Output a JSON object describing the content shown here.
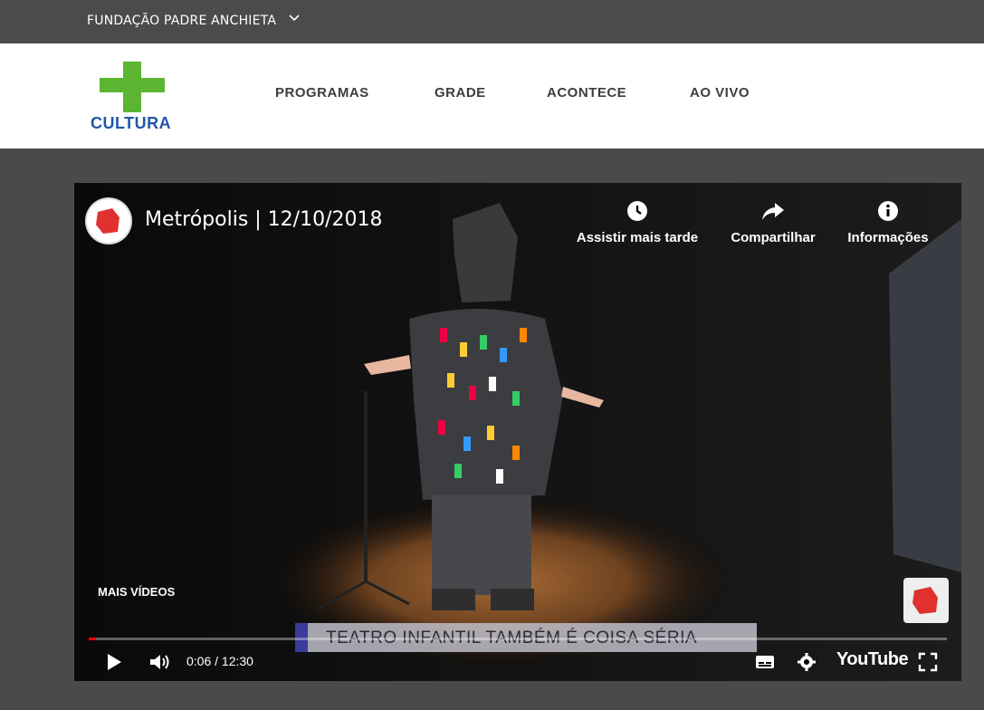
{
  "topbar": {
    "org": "FUNDAÇÃO PADRE ANCHIETA"
  },
  "header": {
    "logo_word": "CULTURA",
    "nav": [
      "PROGRAMAS",
      "GRADE",
      "ACONTECE",
      "AO VIVO"
    ]
  },
  "player": {
    "title": "Metrópolis | 12/10/2018",
    "actions": [
      {
        "label": "Assistir mais tarde",
        "icon": "clock-icon"
      },
      {
        "label": "Compartilhar",
        "icon": "share-icon"
      },
      {
        "label": "Informações",
        "icon": "info-icon"
      }
    ],
    "more_videos": "MAIS VÍDEOS",
    "lower_third": "TEATRO INFANTIL TAMBÉM É COISA SÉRIA",
    "time": "0:06 / 12:30",
    "progress": 0.008,
    "brand": "YouTube",
    "colors": {
      "accent": "#ff0000",
      "cultura_green": "#5bb531",
      "cultura_blue": "#1f57a7"
    }
  }
}
